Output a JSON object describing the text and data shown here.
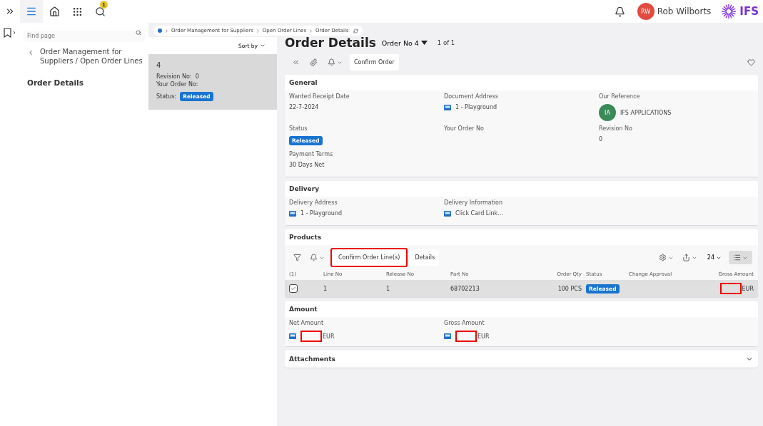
{
  "topbar": {
    "notification_count": "1",
    "user": {
      "initials": "RW",
      "name": "Rob Wilborts"
    },
    "logo": "IFS"
  },
  "navigator": {
    "search": {
      "placeholder": "Find page"
    },
    "back_title": "Order Management for Suppliers / Open Order Lines",
    "items": [
      {
        "label": "Order Details",
        "selected": true
      }
    ]
  },
  "breadcrumb": [
    "Order Management for Suppliers",
    "Open Order Lines",
    "Order Details"
  ],
  "list": {
    "sort_label": "Sort by",
    "records": [
      {
        "title": "4",
        "fields": [
          {
            "label": "Revision No:",
            "value": "0"
          },
          {
            "label": "Your Order No:"
          }
        ],
        "status_label": "Status:",
        "status": "Released",
        "selected": true
      }
    ]
  },
  "page": {
    "title": "Order Details",
    "record_selector": "Order No 4",
    "pager": "1 of 1",
    "commands": [
      {
        "label": "Confirm Order",
        "highlighted": false
      }
    ]
  },
  "general": {
    "title": "General",
    "fields": [
      {
        "label": "Wanted Receipt Date",
        "kind": "text",
        "value": "22-7-2024"
      },
      {
        "label": "Document Address",
        "kind": "address",
        "value": "1 - Playground"
      },
      {
        "label": "Our Reference",
        "kind": "person",
        "initials": "IA",
        "value": "IFS APPLICATIONS"
      },
      {
        "label": "Status",
        "kind": "badge",
        "value": "Released"
      },
      {
        "label": "Your Order No",
        "kind": "text"
      },
      {
        "label": "Revision No",
        "kind": "text",
        "value": "0"
      },
      {
        "label": "Payment Terms",
        "kind": "text",
        "value": "30 Days Net"
      }
    ]
  },
  "delivery": {
    "title": "Delivery",
    "fields": [
      {
        "label": "Delivery Address",
        "kind": "address",
        "value": "1 - Playground"
      },
      {
        "label": "Delivery Information",
        "kind": "address",
        "value": "Click Card Link..."
      }
    ]
  },
  "products": {
    "title": "Products",
    "commands": [
      {
        "label": "Confirm Order Line(s)",
        "highlighted": true
      },
      {
        "label": "Details",
        "highlighted": false
      }
    ],
    "page_size": "24",
    "selected_count": "(1)",
    "columns": [
      "Line No",
      "Release No",
      "Part No",
      "Order Qty",
      "Status",
      "Change Approval",
      "Gross Amount"
    ],
    "rows": [
      {
        "selected": true,
        "line_no": "1",
        "release_no": "1",
        "part_no": "68702213",
        "order_qty": "100 PCS",
        "status": "Released",
        "gross_amount": {
          "currency": "EUR",
          "highlighted": true
        }
      }
    ]
  },
  "amount": {
    "title": "Amount",
    "fields": [
      {
        "label": "Net Amount",
        "currency": "EUR",
        "highlighted": true
      },
      {
        "label": "Gross Amount",
        "currency": "EUR",
        "highlighted": true
      }
    ]
  },
  "attachments": {
    "title": "Attachments",
    "expanded": false
  }
}
